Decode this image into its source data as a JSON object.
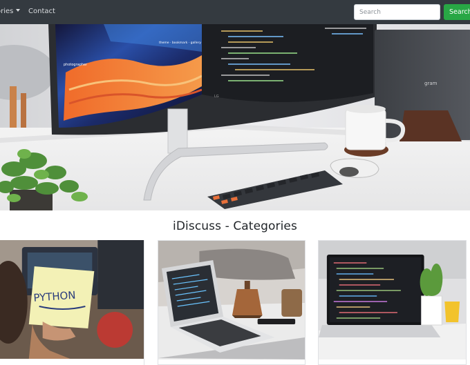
{
  "nav": {
    "categories_label": "ories",
    "contact_label": "Contact"
  },
  "search": {
    "placeholder": "Search",
    "button_label": "Search"
  },
  "hero": {
    "image": "desk-workspace-photo",
    "monitor_brand": "LG",
    "monitor_text_left": "photographer",
    "monitor_text_right": "theme · bookmark · gallery",
    "laptop_brand": "gram"
  },
  "section": {
    "title": "iDiscuss - Categories"
  },
  "cards": [
    {
      "image": "python-sticky-note-photo",
      "note_text": "PYTHON"
    },
    {
      "image": "laptop-coffee-table-photo"
    },
    {
      "image": "laptop-code-desk-photo"
    }
  ],
  "colors": {
    "navbar_bg": "#343a40",
    "search_button": "#28a745",
    "text": "#212529"
  }
}
